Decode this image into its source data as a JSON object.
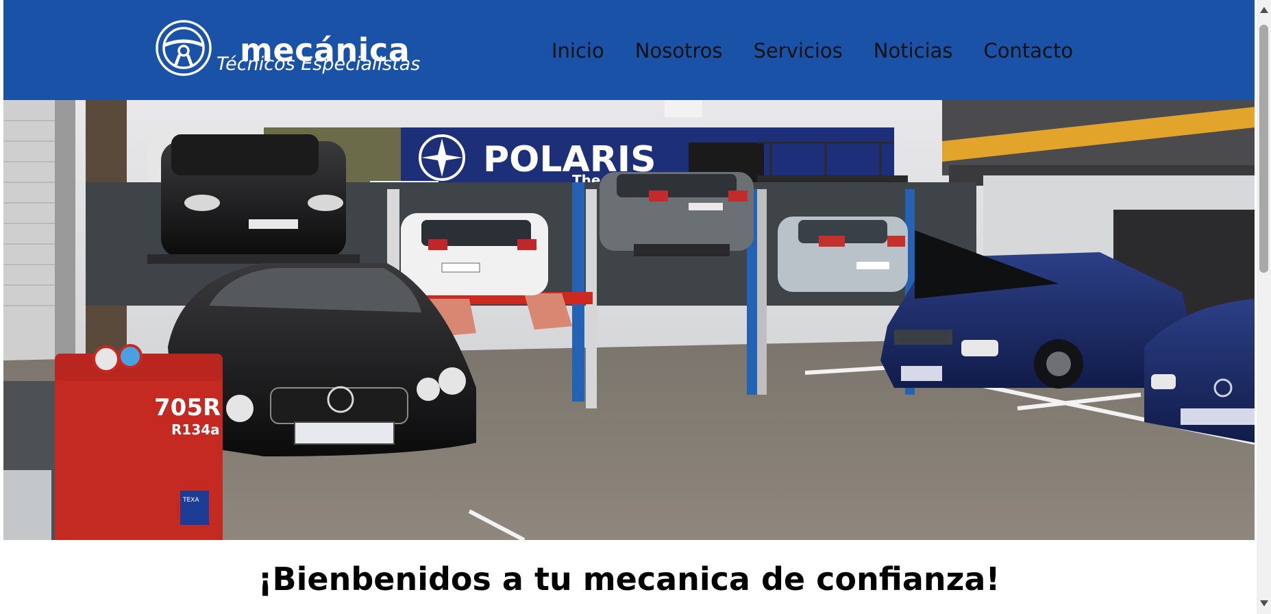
{
  "brand": {
    "name": "mecánica",
    "tagline": "Técnicos Especialistas",
    "logo_icon": "steering-wheel-icon"
  },
  "nav": {
    "items": [
      {
        "label": "Inicio"
      },
      {
        "label": "Nosotros"
      },
      {
        "label": "Servicios"
      },
      {
        "label": "Noticias"
      },
      {
        "label": "Contacto"
      }
    ]
  },
  "hero": {
    "image": "car-workshop-photo",
    "banner_text": "POLARIS",
    "banner_subtext": "The",
    "machine_text": "705R",
    "machine_subtext": "R134a",
    "machine_brand": "TEXA"
  },
  "main": {
    "welcome_heading": "¡Bienbenidos a tu mecanica de confianza!"
  },
  "colors": {
    "header_bg": "#1a52a8",
    "nav_text": "#111111",
    "logo_text": "#ffffff"
  }
}
